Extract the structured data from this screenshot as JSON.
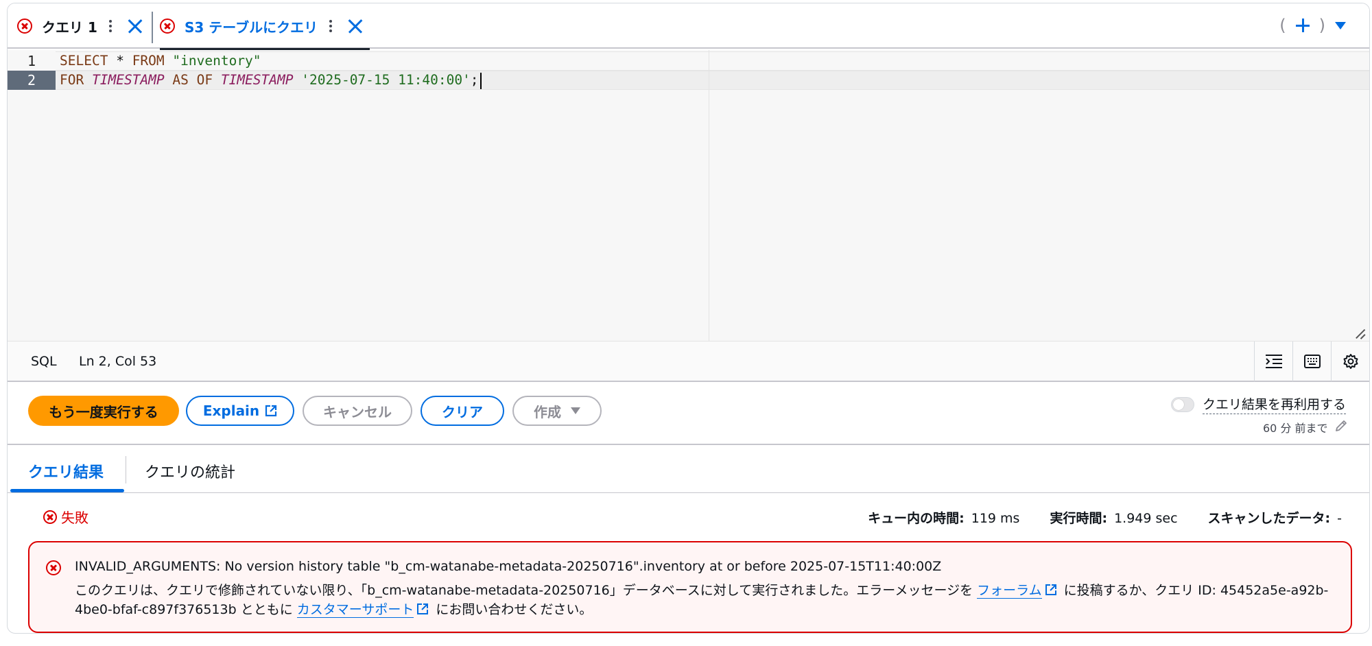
{
  "tabs": [
    {
      "label": "クエリ 1",
      "active": false
    },
    {
      "label": "S3 テーブルにクエリ",
      "active": true
    }
  ],
  "tab_actions": {
    "open_paren": "(",
    "close_paren": ")"
  },
  "editor": {
    "line_numbers": [
      "1",
      "2"
    ],
    "line1": {
      "t1": "SELECT",
      "t2": " * ",
      "t3": "FROM",
      "t4": " \"inventory\""
    },
    "line2": {
      "t1": "FOR",
      "t2": " ",
      "t3": "TIMESTAMP",
      "t4": " AS OF ",
      "t5": "TIMESTAMP",
      "t6": " '2025-07-15 11:40:00'",
      "t7": ";"
    }
  },
  "statusbar": {
    "language": "SQL",
    "position": "Ln 2, Col 53"
  },
  "actions": {
    "run_again": "もう一度実行する",
    "explain": "Explain",
    "cancel": "キャンセル",
    "clear": "クリア",
    "create": "作成",
    "reuse_results": "クエリ結果を再利用する",
    "reuse_sub": "60 分 前まで"
  },
  "result_tabs": {
    "results": "クエリ結果",
    "stats": "クエリの統計"
  },
  "status": {
    "state": "失敗",
    "queue_label": "キュー内の時間:",
    "queue_value": "119 ms",
    "exec_label": "実行時間:",
    "exec_value": "1.949 sec",
    "scan_label": "スキャンしたデータ:",
    "scan_value": "-"
  },
  "error": {
    "title": "INVALID_ARGUMENTS: No version history table \"b_cm-watanabe-metadata-20250716\".inventory at or before 2025-07-15T11:40:00Z",
    "body_part1": "このクエリは、クエリで修飾されていない限り、「b_cm-watanabe-metadata-20250716」データベースに対して実行されました。エラーメッセージを ",
    "forum_link": "フォーラム",
    "body_part2": " に投稿するか、クエリ ID: 45452a5e-a92b-4be0-bfaf-c897f376513b とともに ",
    "support_link": "カスタマーサポート",
    "body_part3": " にお問い合わせください。"
  },
  "colors": {
    "accent": "#006ce0",
    "error": "#db0000",
    "primary_button": "#ff9900"
  }
}
